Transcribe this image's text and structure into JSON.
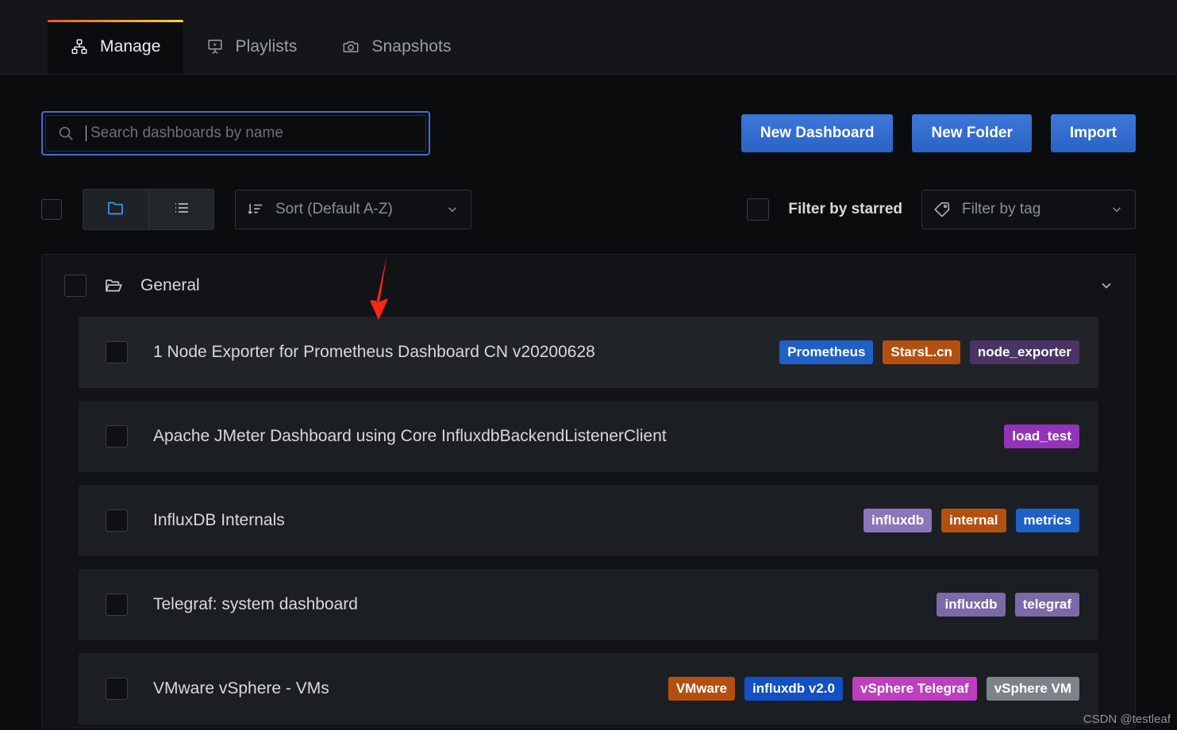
{
  "nav": {
    "tabs": [
      {
        "label": "Manage",
        "icon": "sitemap-icon",
        "active": true
      },
      {
        "label": "Playlists",
        "icon": "presentation-play-icon",
        "active": false
      },
      {
        "label": "Snapshots",
        "icon": "camera-icon",
        "active": false
      }
    ]
  },
  "search": {
    "placeholder": "Search dashboards by name",
    "value": "",
    "icon": "search-icon"
  },
  "actions": {
    "new_dashboard": "New Dashboard",
    "new_folder": "New Folder",
    "import": "Import"
  },
  "toolbar": {
    "select_all_checkbox": "",
    "view_folders_icon": "folder-icon",
    "view_list_icon": "list-icon",
    "sort": {
      "label": "Sort (Default A-Z)",
      "icon": "sort-amount-down-icon",
      "chevron": "chevron-down-icon"
    },
    "filter_starred_label": "Filter by starred",
    "filter_tag": {
      "placeholder": "Filter by tag",
      "icon": "tag-icon",
      "chevron": "chevron-down-icon"
    }
  },
  "folder": {
    "name": "General",
    "icon": "folder-open-icon",
    "chevron": "chevron-down-icon"
  },
  "dashboards": [
    {
      "title": "1 Node Exporter for Prometheus Dashboard CN v20200628",
      "highlighted": true,
      "tags": [
        {
          "label": "Prometheus",
          "color": "#1f60c4"
        },
        {
          "label": "StarsL.cn",
          "color": "#b4500f"
        },
        {
          "label": "node_exporter",
          "color": "#4a3466"
        }
      ]
    },
    {
      "title": "Apache JMeter Dashboard using Core InfluxdbBackendListenerClient",
      "highlighted": false,
      "tags": [
        {
          "label": "load_test",
          "color": "#9334b8"
        }
      ]
    },
    {
      "title": "InfluxDB Internals",
      "highlighted": false,
      "tags": [
        {
          "label": "influxdb",
          "color": "#8e75b8"
        },
        {
          "label": "internal",
          "color": "#b4500f"
        },
        {
          "label": "metrics",
          "color": "#1f60c4"
        }
      ]
    },
    {
      "title": "Telegraf: system dashboard",
      "highlighted": false,
      "tags": [
        {
          "label": "influxdb",
          "color": "#7b6aa8"
        },
        {
          "label": "telegraf",
          "color": "#7b6aa8"
        }
      ]
    },
    {
      "title": "VMware vSphere - VMs",
      "highlighted": false,
      "tags": [
        {
          "label": "VMware",
          "color": "#b4500f"
        },
        {
          "label": "influxdb v2.0",
          "color": "#1250c4"
        },
        {
          "label": "vSphere Telegraf",
          "color": "#bd3fbd"
        },
        {
          "label": "vSphere VM",
          "color": "#7e8389"
        }
      ]
    }
  ],
  "annotation": {
    "arrow_color": "#fb2616"
  },
  "watermark": "CSDN @testleaf"
}
